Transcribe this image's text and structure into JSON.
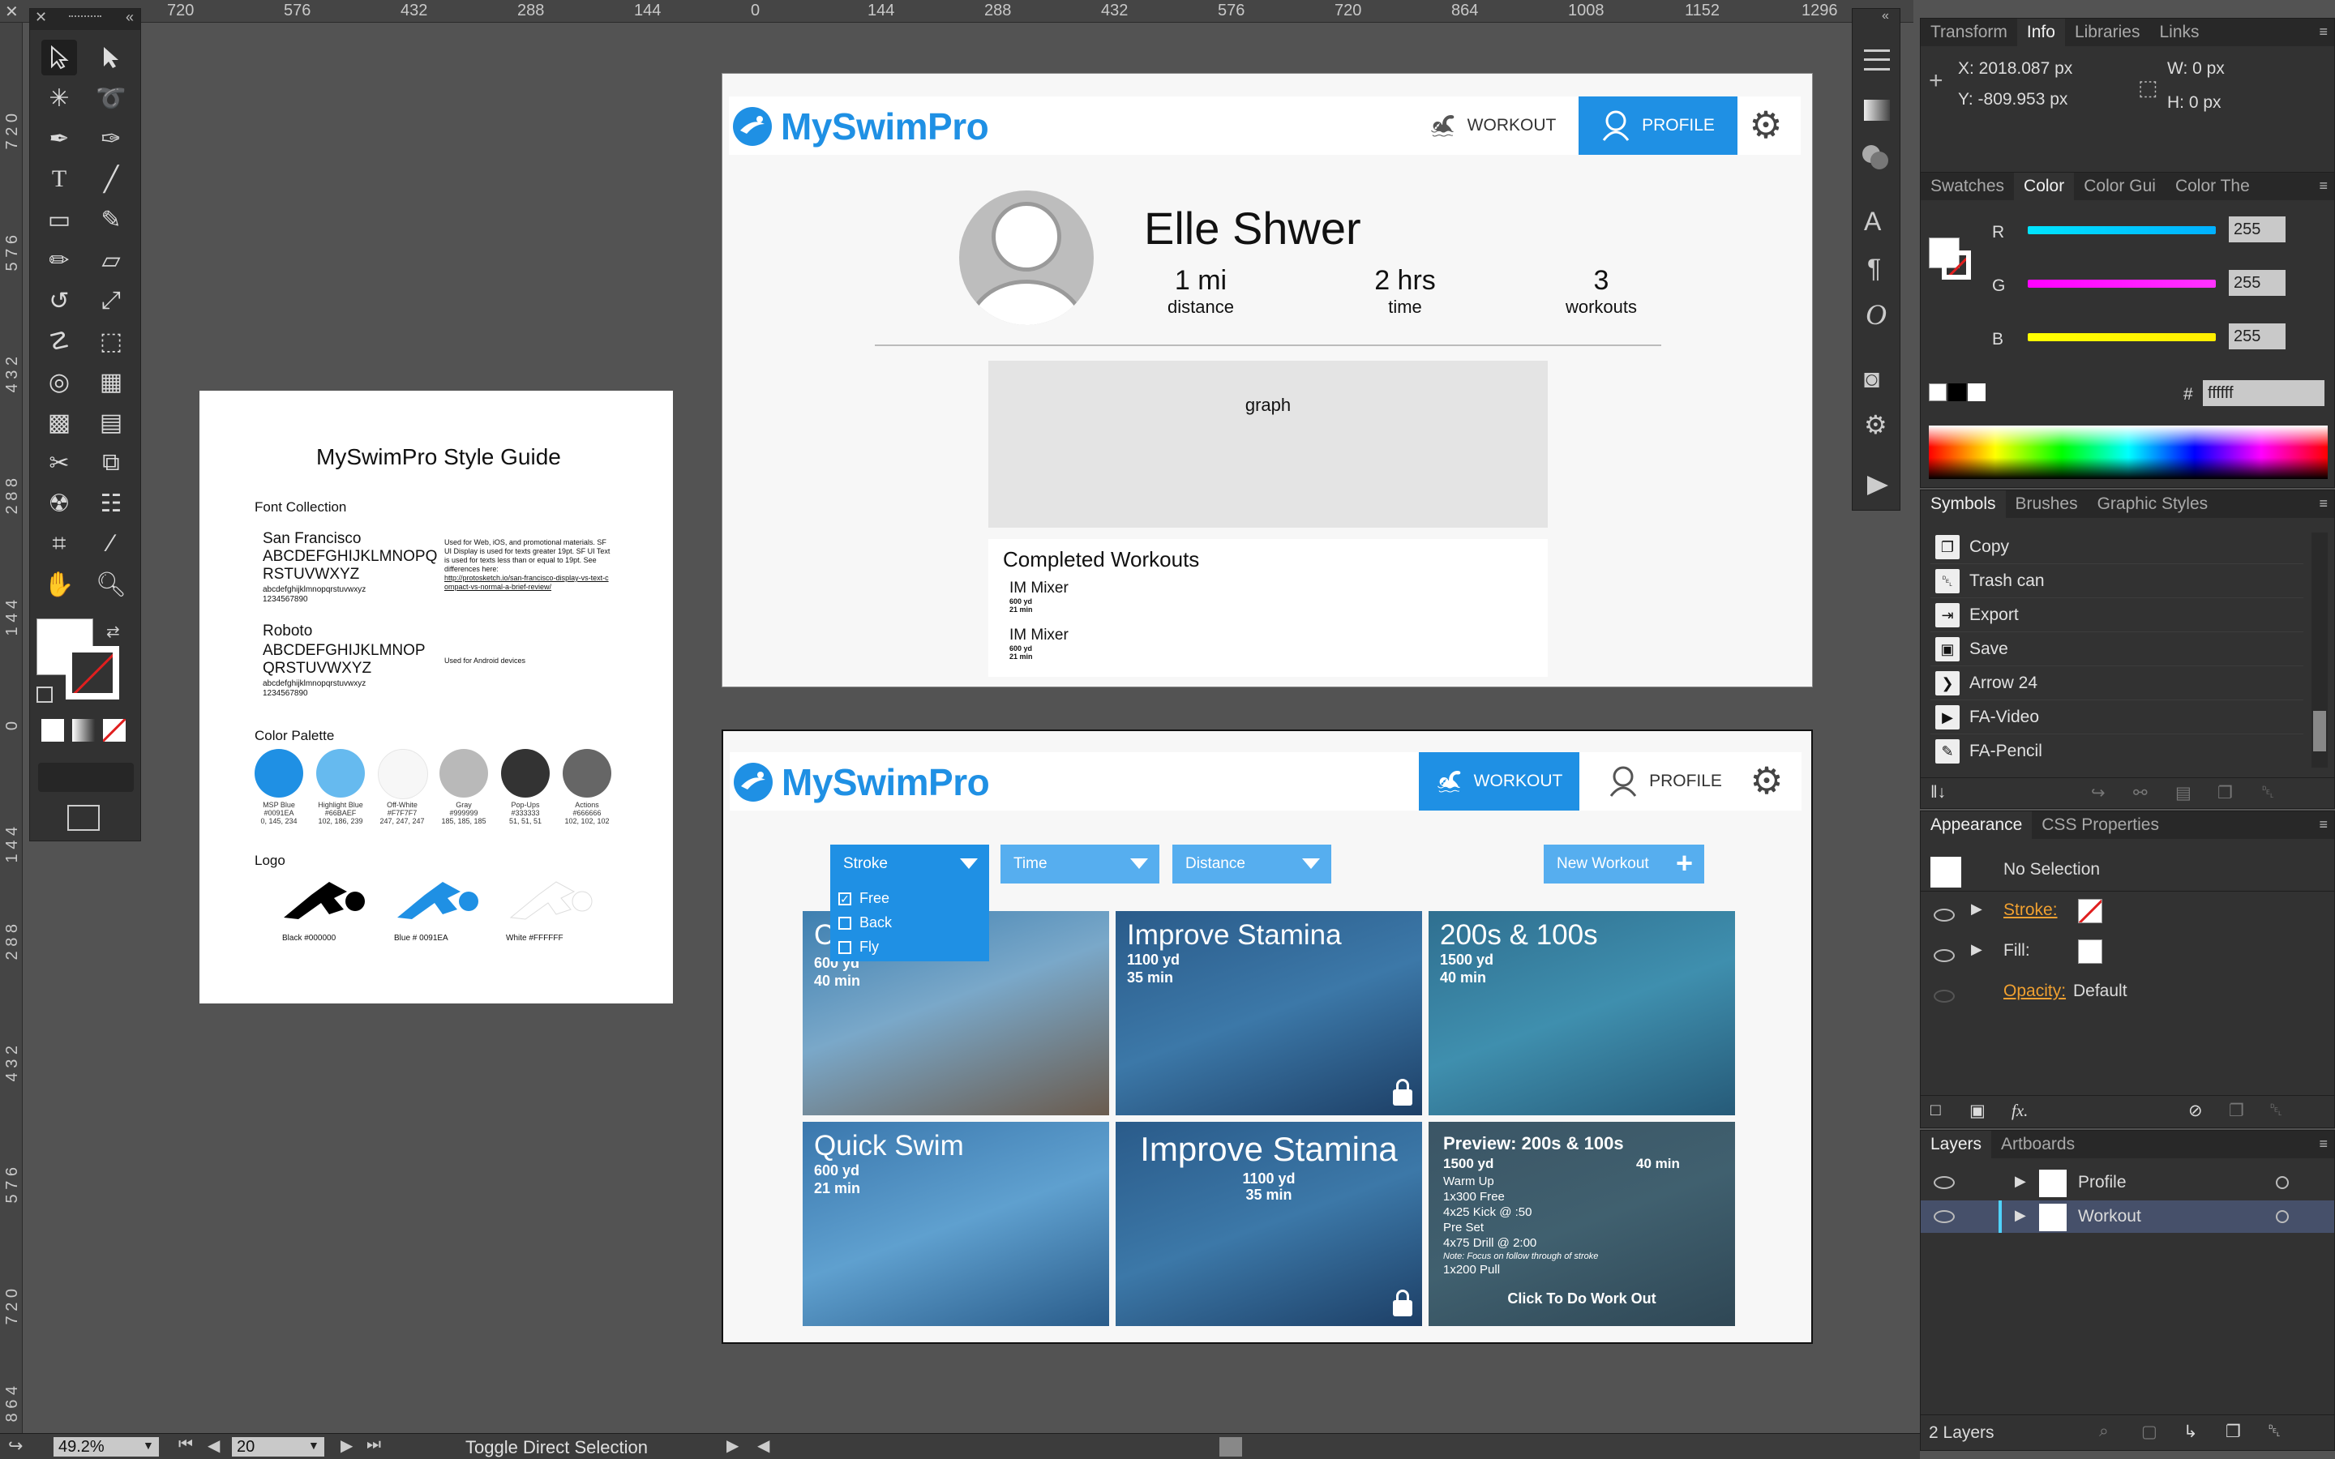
{
  "ruler_top": [
    "720",
    "576",
    "432",
    "288",
    "144",
    "0",
    "144",
    "288",
    "432",
    "576",
    "720",
    "864",
    "1008",
    "1152",
    "1296"
  ],
  "ruler_left": [
    "0",
    "7 2 0",
    "5 7 6",
    "4 3 2",
    "2 8 8",
    "1 4 4",
    "0",
    "1 4 4",
    "2 8 8",
    "4 3 2",
    "5 7 6",
    "7 2 0",
    "8 6 4"
  ],
  "profile_artboard": {
    "logo": "MySwimPro",
    "nav_workout": "WORKOUT",
    "nav_profile": "PROFILE",
    "user_name": "Elle Shwer",
    "stats": [
      {
        "value": "1 mi",
        "label": "distance"
      },
      {
        "value": "2 hrs",
        "label": "time"
      },
      {
        "value": "3",
        "label": "workouts"
      }
    ],
    "graph_label": "graph",
    "completed_title": "Completed Workouts",
    "completed": [
      {
        "name": "IM Mixer",
        "distance": "600 yd",
        "time": "21 min"
      },
      {
        "name": "IM Mixer",
        "distance": "600 yd",
        "time": "21 min"
      }
    ]
  },
  "workout_artboard": {
    "logo": "MySwimPro",
    "nav_workout": "WORKOUT",
    "nav_profile": "PROFILE",
    "filters": {
      "stroke": "Stroke",
      "time": "Time",
      "distance": "Distance"
    },
    "stroke_options": [
      "Free",
      "Back",
      "Fly"
    ],
    "new_workout": "New Workout",
    "tiles": [
      {
        "title": "C",
        "distance": "600 yd",
        "time": "40 min"
      },
      {
        "title": "Improve Stamina",
        "distance": "1100 yd",
        "time": "35 min"
      },
      {
        "title": "200s & 100s",
        "distance": "1500 yd",
        "time": "40 min"
      },
      {
        "title": "Quick Swim",
        "distance": "600 yd",
        "time": "21 min"
      },
      {
        "title": "Improve Stamina",
        "distance": "1100 yd",
        "time": "35 min"
      }
    ],
    "preview": {
      "title": "Preview: 200s & 100s",
      "distance": "1500 yd",
      "time": "40 min",
      "lines": [
        "Warm Up",
        "1x300 Free",
        "4x25 Kick @ :50",
        "Pre Set",
        "4x75 Drill @ 2:00"
      ],
      "note": "Note: Focus on follow through of stroke",
      "last": "1x200 Pull",
      "cta": "Click To Do Work Out"
    }
  },
  "style_guide": {
    "title": "MySwimPro Style Guide",
    "font_collection": "Font Collection",
    "sf_name": "San Francisco",
    "sf_upper": "ABCDEFGHIJKLMNOPQ RSTUVWXYZ",
    "sf_lower": "abcdefghijklmnopqrstuvwxyz",
    "sf_digits": "1234567890",
    "sf_note": "Used for Web, iOS, and promotional materials. SF UI Display is used for texts greater 19pt. SF UI Text is used for texts less than or equal to 19pt. See differences here:",
    "sf_link": "http://protosketch.io/san-francisco-display-vs-text-compact-vs-normal-a-brief-review/",
    "roboto_name": "Roboto",
    "roboto_upper": "ABCDEFGHIJKLMNOP QRSTUVWXYZ",
    "roboto_lower": "abcdefghijklmnopqrstuvwxyz",
    "roboto_digits": "1234567890",
    "roboto_note": "Used for Android devices",
    "palette_title": "Color Palette",
    "palette": [
      {
        "name": "MSP Blue",
        "hex": "#0091EA",
        "rgb": "0, 145, 234",
        "color": "#1f90e4"
      },
      {
        "name": "Highlight Blue",
        "hex": "#66BAEF",
        "rgb": "102, 186, 239",
        "color": "#66baef"
      },
      {
        "name": "Off-White",
        "hex": "#F7F7F7",
        "rgb": "247, 247, 247",
        "color": "#f7f7f7"
      },
      {
        "name": "Gray",
        "hex": "#999999",
        "rgb": "185, 185, 185",
        "color": "#b9b9b9"
      },
      {
        "name": "Pop-Ups",
        "hex": "#333333",
        "rgb": "51, 51, 51",
        "color": "#333333"
      },
      {
        "name": "Actions",
        "hex": "#666666",
        "rgb": "102, 102, 102",
        "color": "#666666"
      }
    ],
    "logo_title": "Logo",
    "logo_captions": [
      "Black #000000",
      "Blue # 0091EA",
      "White #FFFFFF"
    ]
  },
  "info_panel": {
    "tabs": [
      "Transform",
      "Info",
      "Libraries",
      "Links"
    ],
    "x": "X: 2018.087 px",
    "y": "Y: -809.953 px",
    "w": "W: 0 px",
    "h": "H: 0 px"
  },
  "color_panel": {
    "tabs": [
      "Swatches",
      "Color",
      "Color Gui",
      "Color The"
    ],
    "r_label": "R",
    "g_label": "G",
    "b_label": "B",
    "r": "255",
    "g": "255",
    "b": "255",
    "hash": "#",
    "hex": "ffffff"
  },
  "symbols_panel": {
    "tabs": [
      "Symbols",
      "Brushes",
      "Graphic Styles"
    ],
    "items": [
      "Copy",
      "Trash can",
      "Export",
      "Save",
      "Arrow 24",
      "FA-Video",
      "FA-Pencil"
    ]
  },
  "appearance_panel": {
    "tabs": [
      "Appearance",
      "CSS Properties"
    ],
    "selection": "No Selection",
    "stroke": "Stroke:",
    "fill": "Fill:",
    "opacity_label": "Opacity:",
    "opacity_value": "Default",
    "fx": "fx."
  },
  "layers_panel": {
    "tabs": [
      "Layers",
      "Artboards"
    ],
    "layers": [
      "Profile",
      "Workout"
    ],
    "count": "2 Layers"
  },
  "status_bar": {
    "zoom": "49.2%",
    "artboard_number": "20",
    "status": "Toggle Direct Selection"
  }
}
